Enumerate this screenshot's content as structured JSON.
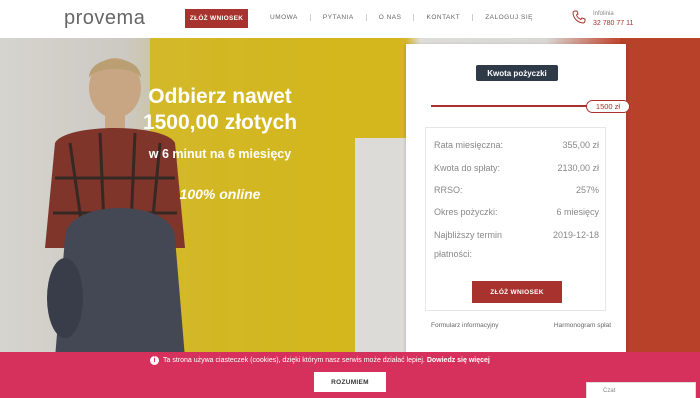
{
  "header": {
    "logo": "provema",
    "cta_label": "ZŁÓŻ WNIOSEK",
    "nav": [
      "UMOWA",
      "PYTANIA",
      "O NAS",
      "KONTAKT",
      "ZALOGUJ SIĘ"
    ],
    "phone_label": "Infolinia",
    "phone_number": "32 780 77 11"
  },
  "hero": {
    "headline_line1": "Odbierz nawet",
    "headline_line2": "1500,00 złotych",
    "subline": "w 6 minut na 6 miesięcy",
    "online": "100% online"
  },
  "calculator": {
    "badge": "Kwota pożyczki",
    "slider_value": "1500 zł",
    "slider_fraction": 1.0,
    "rows": [
      {
        "label": "Rata miesięczna:",
        "value": "355,00 zł"
      },
      {
        "label": "Kwota do spłaty:",
        "value": "2130,00 zł"
      },
      {
        "label": "RRSO:",
        "value": "257%"
      },
      {
        "label": "Okres pożyczki:",
        "value": "6 miesięcy"
      },
      {
        "label": "Najbliższy termin",
        "value": "2019-12-18"
      }
    ],
    "row5_second": "płatności:",
    "apply_label": "ZŁÓŻ WNIOSEK",
    "link_left": "Formularz informacyjny",
    "link_right": "Harmonogram spłat"
  },
  "cookie": {
    "info_icon": "i",
    "text": "Ta strona używa ciasteczek (cookies), dzięki którym nasz serwis może działać lepiej.",
    "more": "Dowiedz się więcej",
    "button": "ROZUMIEM"
  },
  "chat": {
    "label": "Czat"
  },
  "colors": {
    "brand": "#a8322d",
    "cookie_bar": "#d6315c",
    "badge": "#2f3a48"
  }
}
